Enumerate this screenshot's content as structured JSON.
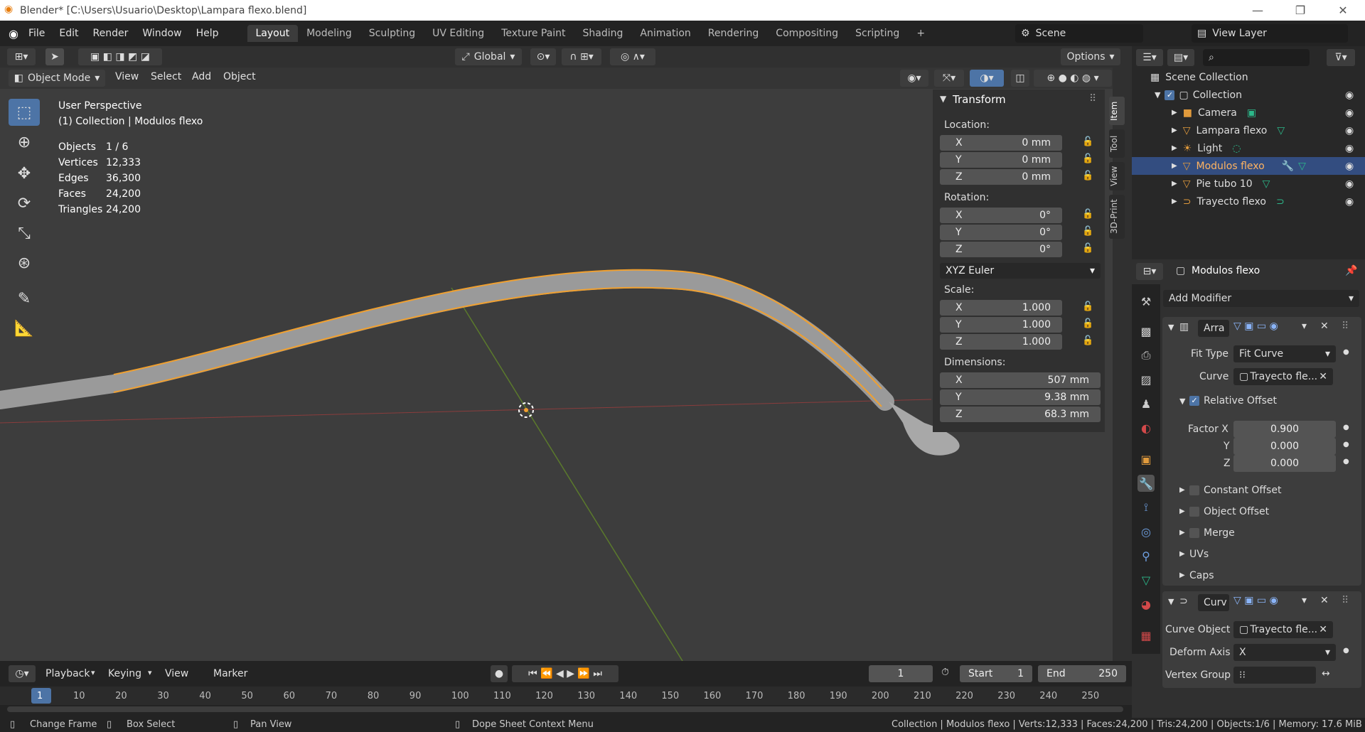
{
  "window": {
    "title": "Blender* [C:\\Users\\Usuario\\Desktop\\Lampara flexo.blend]",
    "min": "—",
    "max": "❐",
    "close": "✕"
  },
  "menu": [
    "File",
    "Edit",
    "Render",
    "Window",
    "Help"
  ],
  "workspaces": [
    "Layout",
    "Modeling",
    "Sculpting",
    "UV Editing",
    "Texture Paint",
    "Shading",
    "Animation",
    "Rendering",
    "Compositing",
    "Scripting"
  ],
  "workspace_add": "+",
  "scene": {
    "label": "Scene"
  },
  "view_layer": {
    "label": "View Layer"
  },
  "viewport_header": {
    "transform_orientation": "Global",
    "options": "Options",
    "mode": "Object Mode",
    "menus": [
      "View",
      "Select",
      "Add",
      "Object"
    ]
  },
  "viewport_info": {
    "perspective": "User Perspective",
    "collection": "(1) Collection | Modulos flexo",
    "stats": [
      {
        "label": "Objects",
        "value": "1 / 6"
      },
      {
        "label": "Vertices",
        "value": "12,333"
      },
      {
        "label": "Edges",
        "value": "36,300"
      },
      {
        "label": "Faces",
        "value": "24,200"
      },
      {
        "label": "Triangles",
        "value": "24,200"
      }
    ]
  },
  "npanel": {
    "title": "Transform",
    "location_label": "Location:",
    "location": [
      {
        "axis": "X",
        "value": "0 mm"
      },
      {
        "axis": "Y",
        "value": "0 mm"
      },
      {
        "axis": "Z",
        "value": "0 mm"
      }
    ],
    "rotation_label": "Rotation:",
    "rotation": [
      {
        "axis": "X",
        "value": "0°"
      },
      {
        "axis": "Y",
        "value": "0°"
      },
      {
        "axis": "Z",
        "value": "0°"
      }
    ],
    "rotation_mode": "XYZ Euler",
    "scale_label": "Scale:",
    "scale": [
      {
        "axis": "X",
        "value": "1.000"
      },
      {
        "axis": "Y",
        "value": "1.000"
      },
      {
        "axis": "Z",
        "value": "1.000"
      }
    ],
    "dimensions_label": "Dimensions:",
    "dimensions": [
      {
        "axis": "X",
        "value": "507 mm"
      },
      {
        "axis": "Y",
        "value": "9.38 mm"
      },
      {
        "axis": "Z",
        "value": "68.3 mm"
      }
    ],
    "tabs": [
      "Item",
      "Tool",
      "View",
      "3D-Print"
    ]
  },
  "outliner": {
    "root": "Scene Collection",
    "collection": "Collection",
    "items": [
      {
        "name": "Camera",
        "color": "#e09a3c"
      },
      {
        "name": "Lampara flexo",
        "color": "#e09a3c"
      },
      {
        "name": "Light",
        "color": "#e09a3c"
      },
      {
        "name": "Modulos flexo",
        "color": "#e09a3c"
      },
      {
        "name": "Pie tubo 10",
        "color": "#e09a3c"
      },
      {
        "name": "Trayecto flexo",
        "color": "#e09a3c"
      }
    ]
  },
  "properties": {
    "object_name": "Modulos flexo",
    "add_modifier": "Add Modifier",
    "array": {
      "name": "Arra",
      "fit_type_label": "Fit Type",
      "fit_type": "Fit Curve",
      "curve_label": "Curve",
      "curve": "Trayecto fle...",
      "relative_offset": "Relative Offset",
      "factor_x_label": "Factor X",
      "factor_x": "0.900",
      "y_label": "Y",
      "factor_y": "0.000",
      "z_label": "Z",
      "factor_z": "0.000",
      "constant_offset": "Constant Offset",
      "object_offset": "Object Offset",
      "merge": "Merge",
      "uvs": "UVs",
      "caps": "Caps"
    },
    "curve_mod": {
      "name": "Curv",
      "curve_object_label": "Curve Object",
      "curve_object": "Trayecto fle...",
      "deform_axis_label": "Deform Axis",
      "deform_axis": "X",
      "vertex_group_label": "Vertex Group"
    }
  },
  "timeline": {
    "menus": [
      "Playback",
      "Keying",
      "View",
      "Marker"
    ],
    "current_frame": "1",
    "start_label": "Start",
    "start": "1",
    "end_label": "End",
    "end": "250",
    "ticks": [
      "1",
      "10",
      "20",
      "30",
      "40",
      "50",
      "60",
      "70",
      "80",
      "90",
      "100",
      "110",
      "120",
      "130",
      "140",
      "150",
      "160",
      "170",
      "180",
      "190",
      "200",
      "210",
      "220",
      "230",
      "240",
      "250"
    ]
  },
  "statusbar": {
    "change_frame": "Change Frame",
    "box_select": "Box Select",
    "pan_view": "Pan View",
    "context_menu": "Dope Sheet Context Menu",
    "info": "Collection | Modulos flexo | Verts:12,333 | Faces:24,200 | Tris:24,200 | Objects:1/6 | Memory: 17.6 MiB"
  },
  "colors": {
    "accent": "#4d74a6",
    "selection": "#f0a030",
    "header": "#303030",
    "viewport": "#3d3d3d"
  }
}
